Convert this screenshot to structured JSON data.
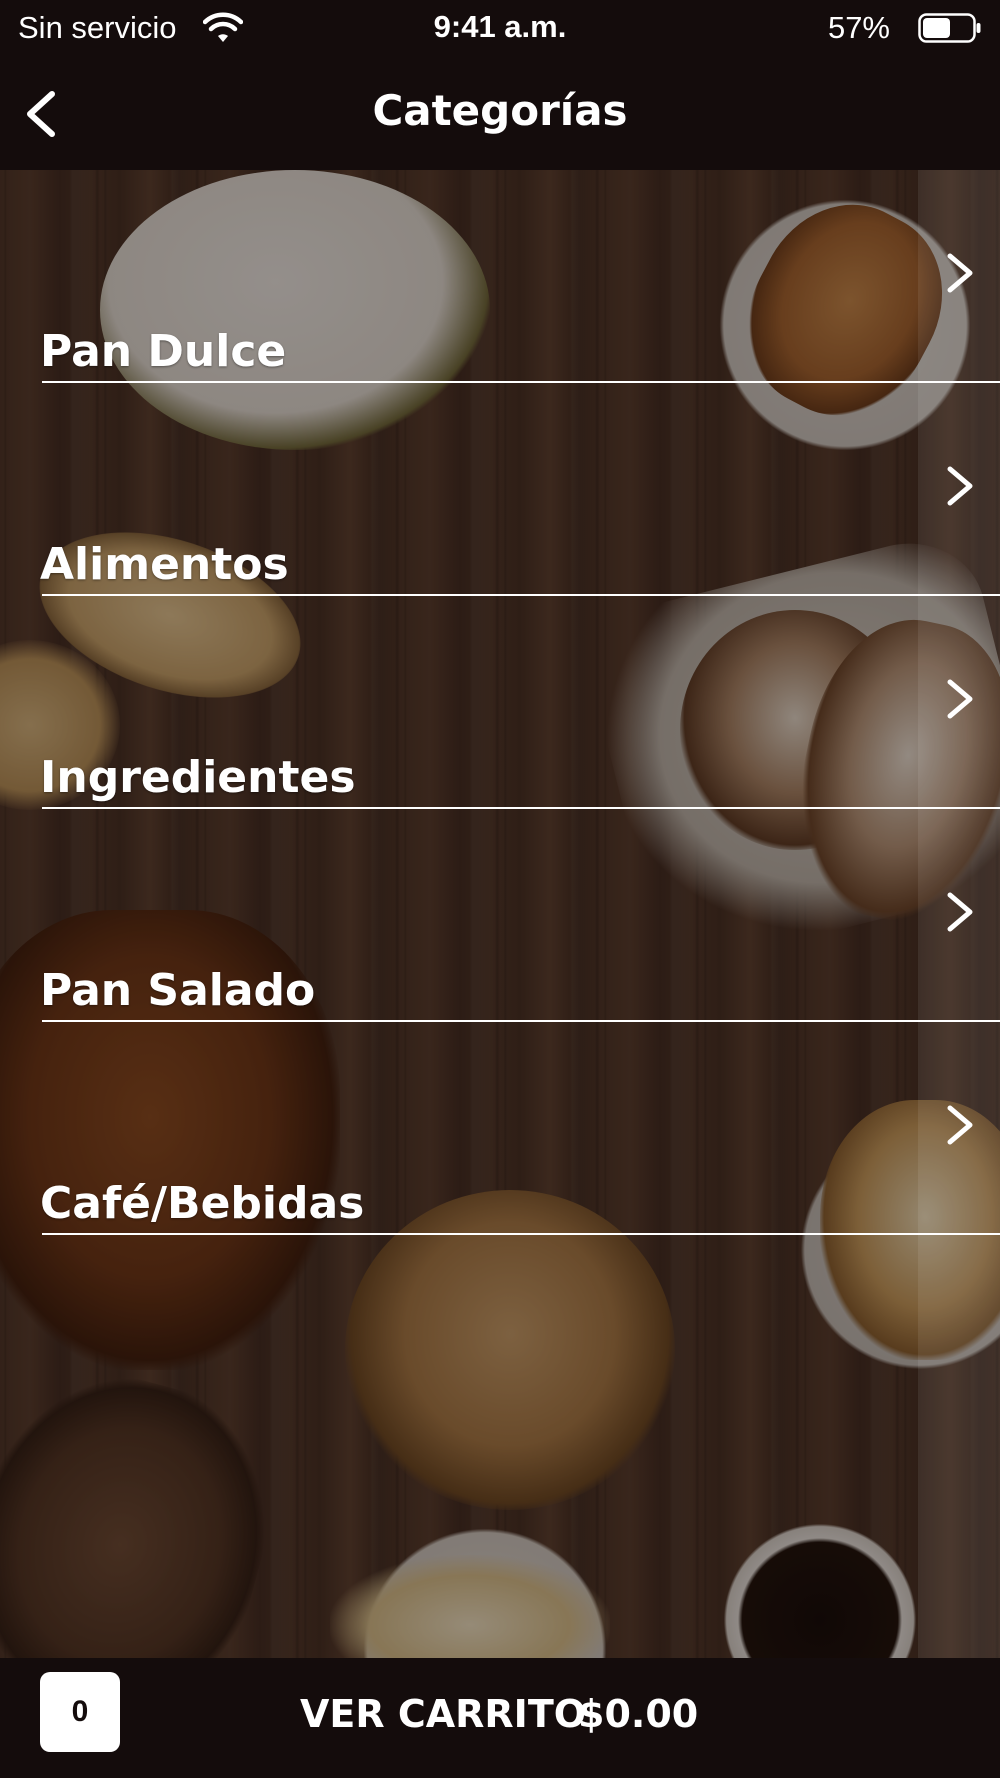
{
  "status_bar": {
    "carrier": "Sin servicio",
    "time": "9:41 a.m.",
    "battery_percent": "57%",
    "battery_level": 0.57
  },
  "nav": {
    "title": "Categorías",
    "back_icon": "chevron-left-icon"
  },
  "categories": [
    {
      "label": "Pan Dulce"
    },
    {
      "label": "Alimentos"
    },
    {
      "label": "Ingredientes"
    },
    {
      "label": "Pan Salado"
    },
    {
      "label": "Café/Bebidas"
    }
  ],
  "cart": {
    "count": "0",
    "label": "VER CARRITO",
    "total": "$0.00"
  },
  "colors": {
    "bar_background": "#140c0c",
    "text": "#ffffff"
  }
}
